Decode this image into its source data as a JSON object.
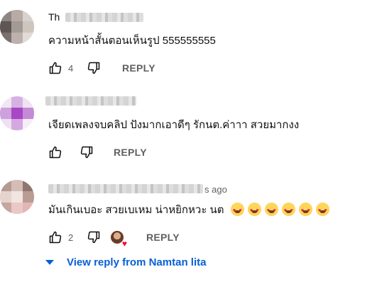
{
  "comments": [
    {
      "author": "Th",
      "text": "ความหน้าสั้นตอนเห็นรูป 555555555",
      "likes": "4",
      "reply_label": "REPLY"
    },
    {
      "author": "",
      "text": "เจียดเพลงจบคลิป ปังมากเอาดีๆ รักนต.ค่าาา สวยมากงง",
      "likes": "",
      "reply_label": "REPLY"
    },
    {
      "author": "",
      "time": "s ago",
      "text": "มันเกินเบอะ สวยเบเหม น่าหยิกหวะ นต",
      "likes": "2",
      "reply_label": "REPLY",
      "emoji_name": "heart-eyes-emoji",
      "emoji_count": 6
    }
  ],
  "view_replies_label": "View reply from Namtan lita",
  "colors": {
    "link": "#065fd4",
    "meta": "#606060",
    "heart": "#ff0033"
  }
}
